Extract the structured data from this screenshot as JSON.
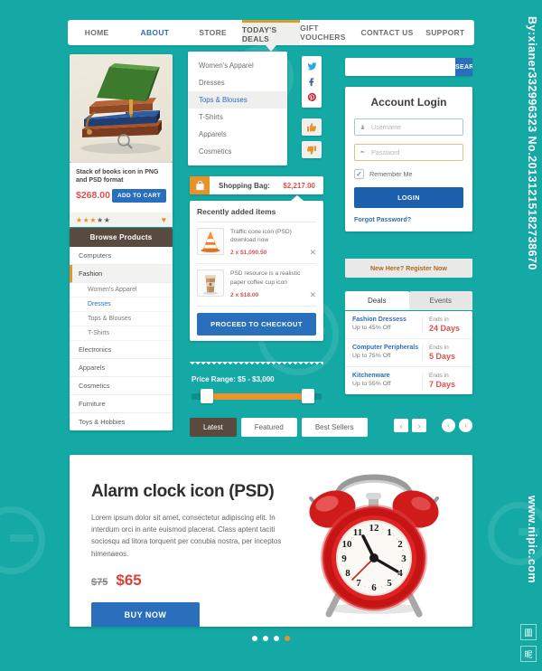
{
  "nav": {
    "items": [
      {
        "label": "HOME",
        "state": "normal"
      },
      {
        "label": "ABOUT",
        "state": "link"
      },
      {
        "label": "STORE",
        "state": "normal"
      },
      {
        "label": "TODAY'S DEALS",
        "state": "active"
      },
      {
        "label": "GIFT VOUCHERS",
        "state": "normal"
      },
      {
        "label": "CONTACT US",
        "state": "normal"
      },
      {
        "label": "SUPPORT",
        "state": "normal"
      }
    ]
  },
  "dropdown": {
    "items": [
      {
        "label": "Women's Apparel",
        "selected": false
      },
      {
        "label": "Dresses",
        "selected": false
      },
      {
        "label": "Tops & Blouses",
        "selected": true
      },
      {
        "label": "T-Shirts",
        "selected": false
      },
      {
        "label": "Apparels",
        "selected": false
      },
      {
        "label": "Cosmetics",
        "selected": false
      }
    ]
  },
  "social": {
    "icons": [
      "twitter-icon",
      "facebook-icon",
      "pinterest-icon"
    ],
    "thumbs_up": "thumbs-up-icon",
    "thumbs_down": "thumbs-down-icon"
  },
  "product": {
    "title": "Stack of books icon in PNG and PSD format",
    "price": "$268.00",
    "cart_label": "ADD TO CART",
    "rating_filled": 3,
    "rating_total": 5,
    "wishlist_icon": "heart-icon",
    "zoom_icon": "magnifier-icon"
  },
  "browse": {
    "header": "Browse Products",
    "items": [
      {
        "label": "Computers",
        "type": "top",
        "state": "normal"
      },
      {
        "label": "Fashion",
        "type": "top",
        "state": "active"
      },
      {
        "label": "Women's Apparel",
        "type": "sub",
        "state": "normal"
      },
      {
        "label": "Dresses",
        "type": "sub",
        "state": "selected"
      },
      {
        "label": "Tops & Blouses",
        "type": "sub",
        "state": "normal"
      },
      {
        "label": "T-Shirts",
        "type": "sub",
        "state": "normal"
      },
      {
        "label": "Electronics",
        "type": "top",
        "state": "normal"
      },
      {
        "label": "Apparels",
        "type": "top",
        "state": "normal"
      },
      {
        "label": "Cosmetics",
        "type": "top",
        "state": "normal"
      },
      {
        "label": "Furniture",
        "type": "top",
        "state": "normal"
      },
      {
        "label": "Toys & Hobbies",
        "type": "top",
        "state": "normal"
      }
    ]
  },
  "bag": {
    "label": "Shopping Bag:",
    "total": "$2,217.00",
    "icon": "shopping-bag-icon"
  },
  "cart": {
    "header": "Recently added items",
    "items": [
      {
        "name": "Traffic cone icon (PSD) download now",
        "qty_price": "2 x $1,090.50",
        "thumb": "traffic-cone-icon"
      },
      {
        "name": "PSD resource is a realistic paper coffee cup icon",
        "qty_price": "2 x $18.00",
        "thumb": "coffee-cup-icon"
      }
    ],
    "checkout_label": "PROCEED TO CHECKOUT"
  },
  "price_range": {
    "label": "Price Range: $5 - $3,000",
    "min": "$5",
    "max": "$3,000"
  },
  "search": {
    "value": "",
    "placeholder": "",
    "button_label": "SEARCH"
  },
  "login": {
    "heading": "Account Login",
    "username_placeholder": "Username",
    "username_value": "",
    "username_icon": "user-icon",
    "password_placeholder": "Password",
    "password_value": "",
    "password_icon": "key-icon",
    "remember_label": "Remember Me",
    "remember_checked": true,
    "check_glyph": "✓",
    "login_label": "LOGIN",
    "forgot_label": "Forgot Password?",
    "register_label": "New Here? Register Now"
  },
  "deals": {
    "tabs": [
      {
        "label": "Deals",
        "active": true
      },
      {
        "label": "Events",
        "active": false
      }
    ],
    "rows": [
      {
        "name": "Fashion Dressess",
        "discount": "Up to 45% Off",
        "ends_label": "Ends in",
        "days": "24 Days"
      },
      {
        "name": "Computer Peripherals",
        "discount": "Up to 75% Off",
        "ends_label": "Ends in",
        "days": "5 Days"
      },
      {
        "name": "Kitchenware",
        "discount": "Up to 55% Off",
        "ends_label": "Ends in",
        "days": "7 Days"
      }
    ]
  },
  "bottom_tabs": {
    "tabs": [
      {
        "label": "Latest",
        "active": true
      },
      {
        "label": "Featured",
        "active": false
      },
      {
        "label": "Best Sellers",
        "active": false
      }
    ],
    "prev_glyph": "‹",
    "next_glyph": "›"
  },
  "banner": {
    "title": "Alarm clock icon (PSD)",
    "description": "Lorem ipsum dolor sit amet, consectetur adipiscing elit. In interdum orci in ante euismod placerat. Class aptent taciti sociosqu ad litora torquent per conubia nostra, per inceptos himenaeos.",
    "old_price": "$75",
    "new_price": "$65",
    "buy_label": "BUY NOW",
    "image": "alarm-clock-icon",
    "dots": 4,
    "active_dot": 4
  },
  "watermark": {
    "right_top": "By:xianer332996323  No.20131215182738670",
    "right_bottom": "www.nipic.com"
  },
  "colors": {
    "background": "#14a9a5",
    "accent_orange": "#e8922a",
    "accent_blue": "#2a6fbb",
    "accent_red": "#d9534f",
    "dark_brown": "#594a3f"
  }
}
